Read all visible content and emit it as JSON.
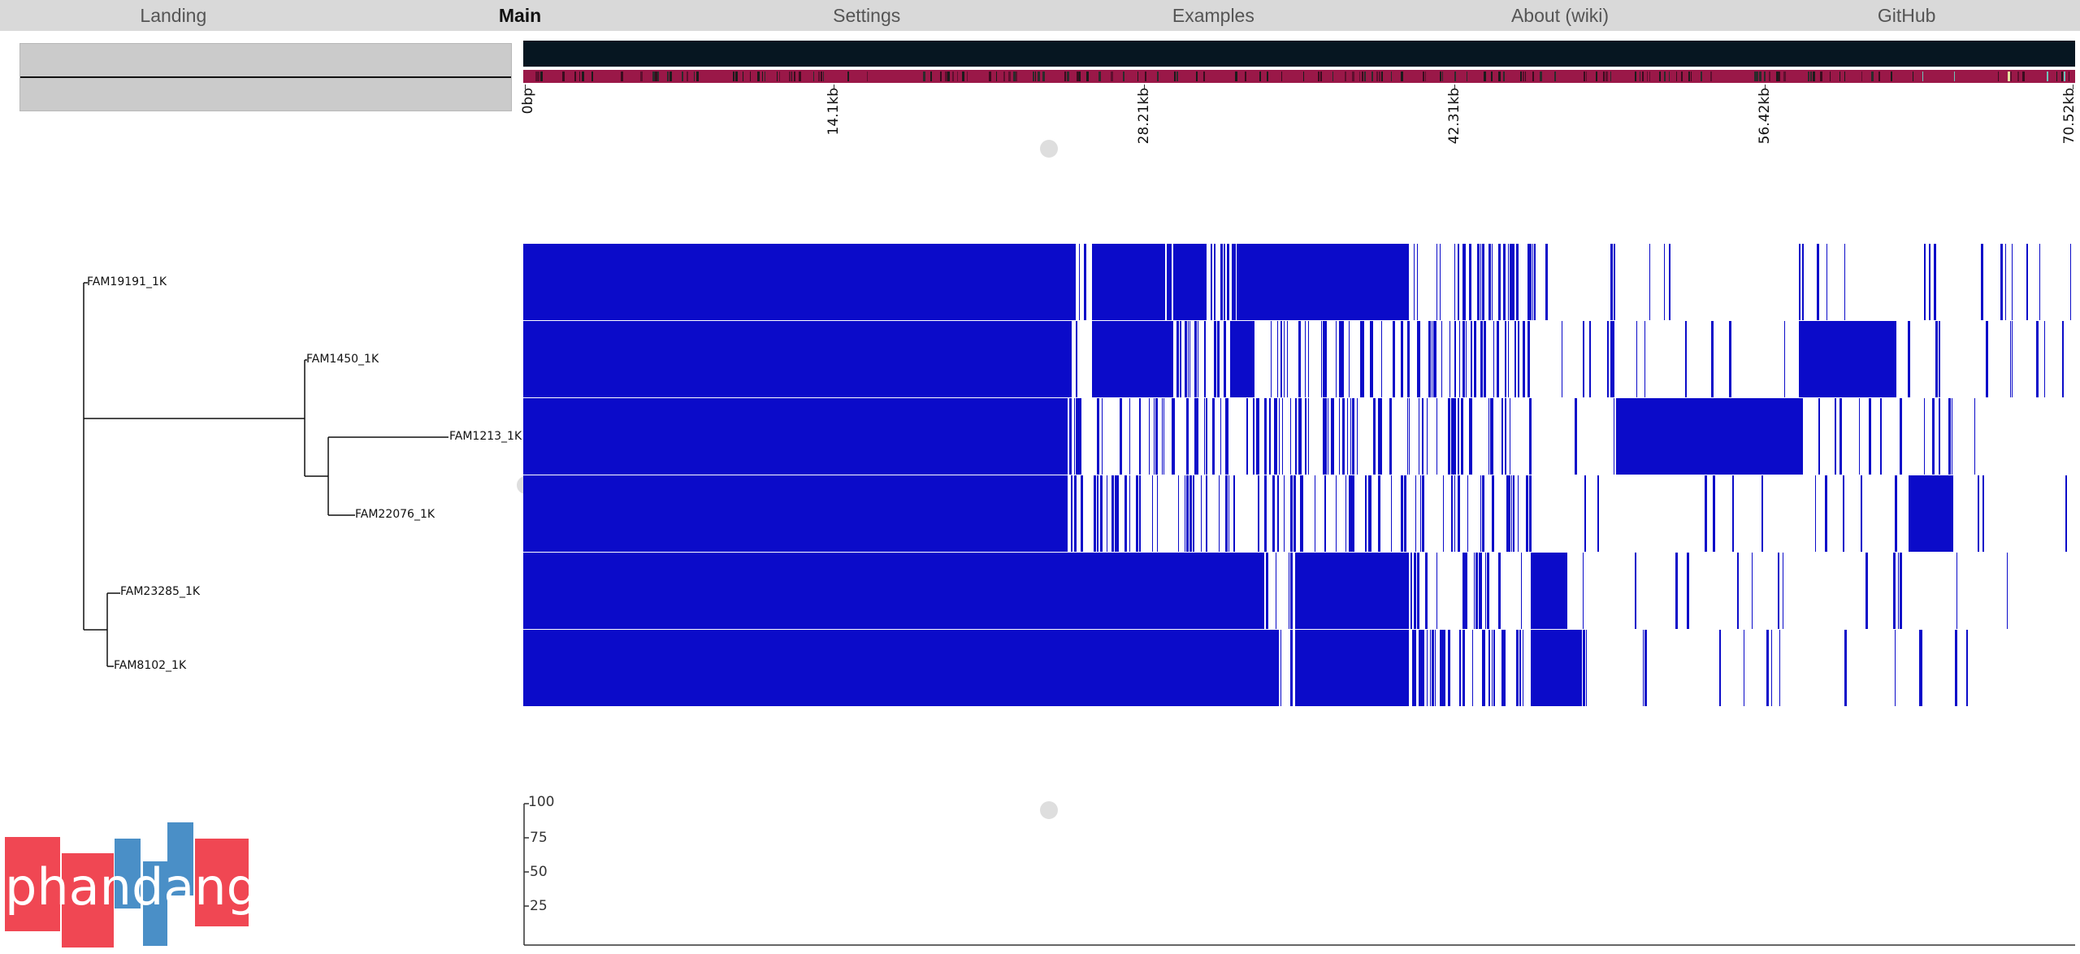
{
  "nav": {
    "items": [
      {
        "label": "Landing",
        "active": false
      },
      {
        "label": "Main",
        "active": true
      },
      {
        "label": "Settings",
        "active": false
      },
      {
        "label": "Examples",
        "active": false
      },
      {
        "label": "About (wiki)",
        "active": false
      },
      {
        "label": "GitHub",
        "active": false
      }
    ]
  },
  "genome_axis": {
    "ticks": [
      "0bp",
      "14.1kb",
      "28.21kb",
      "42.31kb",
      "56.42kb",
      "70.52kb"
    ]
  },
  "tree": {
    "taxa": [
      "FAM19191_1K",
      "FAM1450_1K",
      "FAM1213_1K",
      "FAM22076_1K",
      "FAM23285_1K",
      "FAM8102_1K"
    ]
  },
  "plot": {
    "y_ticks": [
      "100",
      "75",
      "50",
      "25"
    ]
  },
  "logo": {
    "text": "phandango"
  },
  "colors": {
    "heatmap_fill": "#0b0bc9",
    "gene_track_dark": "#061621",
    "gene_track_strip": "#9a1848",
    "logo_red": "#f04753",
    "logo_blue": "#4a8fc7"
  }
}
